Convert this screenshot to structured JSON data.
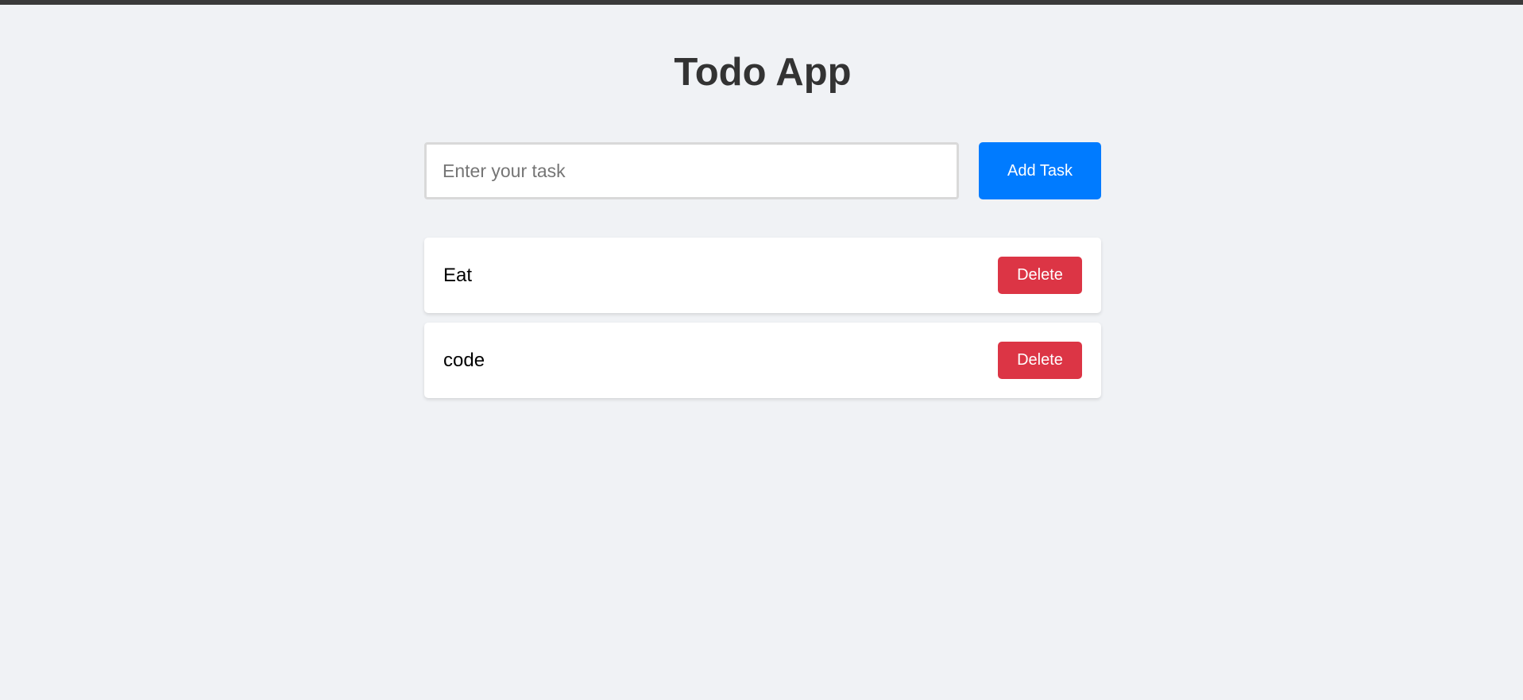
{
  "app": {
    "title": "Todo App"
  },
  "input": {
    "value": "",
    "placeholder": "Enter your task"
  },
  "add_button": {
    "label": "Add Task",
    "color": "#007bff"
  },
  "tasks": [
    {
      "text": "Eat",
      "delete_label": "Delete"
    },
    {
      "text": "code",
      "delete_label": "Delete"
    }
  ],
  "colors": {
    "background": "#f0f2f5",
    "delete": "#dc3545"
  }
}
